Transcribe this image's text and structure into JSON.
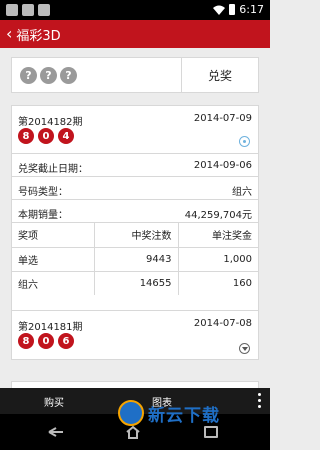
{
  "status_bar": {
    "time": "6:17",
    "notification_icons": [
      "notification-icon",
      "notification-icon",
      "notification-icon"
    ]
  },
  "app_bar": {
    "back_icon": "chevron-left-icon",
    "title": "福彩3D"
  },
  "summary": {
    "unknown_balls": [
      "?",
      "?",
      "?"
    ],
    "prize_label": "兑奖"
  },
  "latest_draw": {
    "issue": "第2014182期",
    "date": "2014-07-09",
    "numbers": [
      "8",
      "0",
      "4"
    ],
    "info": [
      {
        "label": "兑奖截止日期：",
        "value": "2014-09-06"
      },
      {
        "label": "号码类型：",
        "value": "组六"
      },
      {
        "label": "本期销量：",
        "value": "44,259,704元"
      }
    ],
    "table": {
      "headers": [
        "奖项",
        "中奖注数",
        "单注奖金"
      ],
      "rows": [
        [
          "单选",
          "9443",
          "1,000"
        ],
        [
          "组六",
          "14655",
          "160"
        ]
      ]
    }
  },
  "previous_draw": {
    "issue": "第2014181期",
    "date": "2014-07-08",
    "numbers": [
      "8",
      "0",
      "6"
    ]
  },
  "bottom_tabs": {
    "buy": "购买",
    "chart": "图表"
  },
  "watermark": {
    "text": "新云下载"
  },
  "colors": {
    "accent": "#c1141d",
    "ball_unknown": "#9a9a9a",
    "bottom_bar": "#1a1a1a",
    "watermark": "#1f6fc6"
  }
}
